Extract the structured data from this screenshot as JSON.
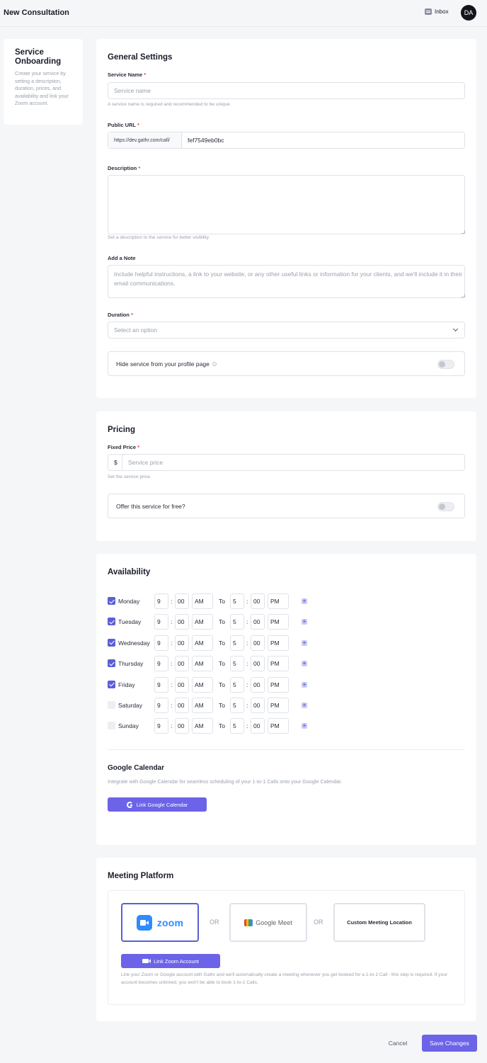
{
  "header": {
    "title": "New Consultation",
    "inbox_label": "Inbox",
    "avatar_initials": "DA"
  },
  "sidebar": {
    "title": "Service Onboarding",
    "description": "Create your service by setting a description, duration, prices, and availability and link your Zoom account."
  },
  "general": {
    "title": "General Settings",
    "service_name_label": "Service Name",
    "service_name_placeholder": "Service name",
    "service_name_hint": "A service name is required and recommended to be unique.",
    "public_url_label": "Public URL",
    "public_url_prefix": "https://dev.gathr.com/call/",
    "public_url_value": "fef7549eb0bc",
    "description_label": "Description",
    "description_value": "",
    "description_hint": "Set a description to the service for better visibility.",
    "note_label": "Add a Note",
    "note_placeholder": "Include helpful instructions, a link to your website, or any other useful links or information for your clients, and we'll include it in their email communications.",
    "duration_label": "Duration",
    "duration_value": "Select an option",
    "hide_label": "Hide service from your profile page",
    "hide_enabled": false
  },
  "required_marker": "*",
  "pricing": {
    "title": "Pricing",
    "fixed_price_label": "Fixed Price",
    "currency": "$",
    "price_placeholder": "Service price",
    "price_hint": "Set the service price.",
    "free_label": "Offer this service for free?",
    "free_enabled": false
  },
  "availability": {
    "title": "Availability",
    "to_label": "To",
    "days": [
      {
        "name": "Monday",
        "checked": true,
        "start_h": "9",
        "start_m": "00",
        "start_ampm": "AM",
        "end_h": "5",
        "end_m": "00",
        "end_ampm": "PM"
      },
      {
        "name": "Tuesday",
        "checked": true,
        "start_h": "9",
        "start_m": "00",
        "start_ampm": "AM",
        "end_h": "5",
        "end_m": "00",
        "end_ampm": "PM"
      },
      {
        "name": "Wednesday",
        "checked": true,
        "start_h": "9",
        "start_m": "00",
        "start_ampm": "AM",
        "end_h": "5",
        "end_m": "00",
        "end_ampm": "PM"
      },
      {
        "name": "Thursday",
        "checked": true,
        "start_h": "9",
        "start_m": "00",
        "start_ampm": "AM",
        "end_h": "5",
        "end_m": "00",
        "end_ampm": "PM"
      },
      {
        "name": "Friday",
        "checked": true,
        "start_h": "9",
        "start_m": "00",
        "start_ampm": "AM",
        "end_h": "5",
        "end_m": "00",
        "end_ampm": "PM"
      },
      {
        "name": "Saturday",
        "checked": false,
        "start_h": "9",
        "start_m": "00",
        "start_ampm": "AM",
        "end_h": "5",
        "end_m": "00",
        "end_ampm": "PM"
      },
      {
        "name": "Sunday",
        "checked": false,
        "start_h": "9",
        "start_m": "00",
        "start_ampm": "AM",
        "end_h": "5",
        "end_m": "00",
        "end_ampm": "PM"
      }
    ],
    "google_title": "Google Calendar",
    "google_desc": "Integrate with Google Calendar for seamless scheduling of your 1-to-1 Calls onto your Google Calendar.",
    "google_button": "Link Google Calendar"
  },
  "meeting": {
    "title": "Meeting Platform",
    "zoom_label": "zoom",
    "meet_label": "Google Meet",
    "or_label": "OR",
    "custom_label": "Custom Meeting Location",
    "link_zoom_button": "Link Zoom Account",
    "hint": "Link your Zoom or Google account with Gathr and we'll automatically create a meeting whenever you get booked for a 1-to-1 Call - this step is required. If your account becomes unlinked, you won't be able to book 1-to-1 Calls.",
    "selected": "zoom"
  },
  "footer": {
    "cancel_label": "Cancel",
    "save_label": "Save Changes"
  },
  "colors": {
    "accent": "#6c63e8",
    "checkbox": "#5b5fd6",
    "zoom": "#2d8cff"
  }
}
